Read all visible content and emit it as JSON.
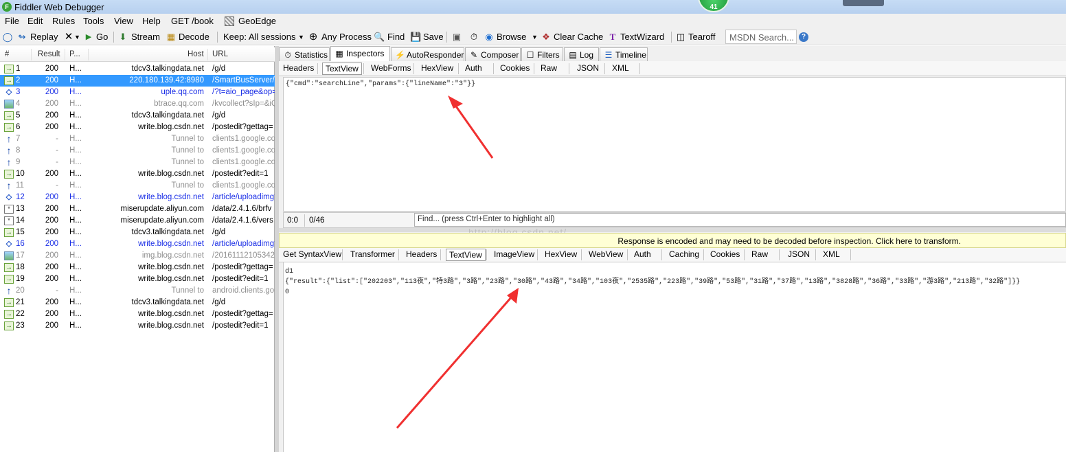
{
  "window": {
    "title": "Fiddler Web Debugger",
    "badge": "41",
    "accent_color": "#3399ff"
  },
  "menu": [
    "File",
    "Edit",
    "Rules",
    "Tools",
    "View",
    "Help",
    "GET /book",
    "GeoEdge"
  ],
  "toolbar": {
    "replay": "Replay",
    "go": "Go",
    "stream": "Stream",
    "decode": "Decode",
    "keep": "Keep: All sessions",
    "process": "Any Process",
    "find": "Find",
    "save": "Save",
    "browse": "Browse",
    "clear_cache": "Clear Cache",
    "textwizard": "TextWizard",
    "tearoff": "Tearoff",
    "msdn_placeholder": "MSDN Search..."
  },
  "sessions": {
    "columns": [
      "#",
      "Result",
      "P...",
      "Host",
      "URL"
    ],
    "rows": [
      {
        "icon": "arrow",
        "id": "1",
        "result": "200",
        "proto": "H...",
        "host": "tdcv3.talkingdata.net",
        "url": "/g/d",
        "style": "normal"
      },
      {
        "icon": "arrow",
        "id": "2",
        "result": "200",
        "proto": "H...",
        "host": "220.180.139.42:8980",
        "url": "/SmartBusServer/M",
        "style": "selected"
      },
      {
        "icon": "diamond",
        "id": "3",
        "result": "200",
        "proto": "H...",
        "host": "uple.qq.com",
        "url": "/?t=aio_page&op=",
        "style": "blue"
      },
      {
        "icon": "img",
        "id": "4",
        "result": "200",
        "proto": "H...",
        "host": "btrace.qq.com",
        "url": "/kvcollect?sIp=&iQ",
        "style": "gray"
      },
      {
        "icon": "arrow",
        "id": "5",
        "result": "200",
        "proto": "H...",
        "host": "tdcv3.talkingdata.net",
        "url": "/g/d",
        "style": "normal"
      },
      {
        "icon": "arrow",
        "id": "6",
        "result": "200",
        "proto": "H...",
        "host": "write.blog.csdn.net",
        "url": "/postedit?gettag=",
        "style": "normal"
      },
      {
        "icon": "up",
        "id": "7",
        "result": "-",
        "proto": "H...",
        "host": "Tunnel to",
        "url": "clients1.google.com",
        "style": "gray"
      },
      {
        "icon": "up",
        "id": "8",
        "result": "-",
        "proto": "H...",
        "host": "Tunnel to",
        "url": "clients1.google.com",
        "style": "gray"
      },
      {
        "icon": "up",
        "id": "9",
        "result": "-",
        "proto": "H...",
        "host": "Tunnel to",
        "url": "clients1.google.com",
        "style": "gray"
      },
      {
        "icon": "arrow",
        "id": "10",
        "result": "200",
        "proto": "H...",
        "host": "write.blog.csdn.net",
        "url": "/postedit?edit=1",
        "style": "normal"
      },
      {
        "icon": "up",
        "id": "11",
        "result": "-",
        "proto": "H...",
        "host": "Tunnel to",
        "url": "clients1.google.com",
        "style": "gray"
      },
      {
        "icon": "diamond",
        "id": "12",
        "result": "200",
        "proto": "H...",
        "host": "write.blog.csdn.net",
        "url": "/article/uploadimg?",
        "style": "blue"
      },
      {
        "icon": "js",
        "id": "13",
        "result": "200",
        "proto": "H...",
        "host": "miserupdate.aliyun.com",
        "url": "/data/2.4.1.6/brfv",
        "style": "normal"
      },
      {
        "icon": "js",
        "id": "14",
        "result": "200",
        "proto": "H...",
        "host": "miserupdate.aliyun.com",
        "url": "/data/2.4.1.6/vers",
        "style": "normal"
      },
      {
        "icon": "arrow",
        "id": "15",
        "result": "200",
        "proto": "H...",
        "host": "tdcv3.talkingdata.net",
        "url": "/g/d",
        "style": "normal"
      },
      {
        "icon": "diamond",
        "id": "16",
        "result": "200",
        "proto": "H...",
        "host": "write.blog.csdn.net",
        "url": "/article/uploadimg?",
        "style": "blue"
      },
      {
        "icon": "img",
        "id": "17",
        "result": "200",
        "proto": "H...",
        "host": "img.blog.csdn.net",
        "url": "/20161112105342",
        "style": "gray"
      },
      {
        "icon": "arrow",
        "id": "18",
        "result": "200",
        "proto": "H...",
        "host": "write.blog.csdn.net",
        "url": "/postedit?gettag=",
        "style": "normal"
      },
      {
        "icon": "arrow",
        "id": "19",
        "result": "200",
        "proto": "H...",
        "host": "write.blog.csdn.net",
        "url": "/postedit?edit=1",
        "style": "normal"
      },
      {
        "icon": "up",
        "id": "20",
        "result": "-",
        "proto": "H...",
        "host": "Tunnel to",
        "url": "android.clients.goo",
        "style": "gray"
      },
      {
        "icon": "arrow",
        "id": "21",
        "result": "200",
        "proto": "H...",
        "host": "tdcv3.talkingdata.net",
        "url": "/g/d",
        "style": "normal"
      },
      {
        "icon": "arrow",
        "id": "22",
        "result": "200",
        "proto": "H...",
        "host": "write.blog.csdn.net",
        "url": "/postedit?gettag=",
        "style": "normal"
      },
      {
        "icon": "arrow",
        "id": "23",
        "result": "200",
        "proto": "H...",
        "host": "write.blog.csdn.net",
        "url": "/postedit?edit=1",
        "style": "normal"
      }
    ]
  },
  "main_tabs": [
    "Statistics",
    "Inspectors",
    "AutoResponder",
    "Composer",
    "Filters",
    "Log",
    "Timeline"
  ],
  "request": {
    "tabs": [
      "Headers",
      "TextView",
      "WebForms",
      "HexView",
      "Auth",
      "Cookies",
      "Raw",
      "JSON",
      "XML"
    ],
    "active_tab": "TextView",
    "body": "{\"cmd\":\"searchLine\",\"params\":{\"lineName\":\"3\"}}",
    "caret": "0:0",
    "count": "0/46",
    "find_placeholder": "Find... (press Ctrl+Enter to highlight all)"
  },
  "watermark": "http://blog.csdn.net/",
  "response": {
    "warning": "Response is encoded and may need to be decoded before inspection. Click here to transform.",
    "tabs": [
      "Get SyntaxView",
      "Transformer",
      "Headers",
      "TextView",
      "ImageView",
      "HexView",
      "WebView",
      "Auth",
      "Caching",
      "Cookies",
      "Raw",
      "JSON",
      "XML"
    ],
    "active_tab": "TextView",
    "lines": [
      "d1",
      "{\"result\":{\"list\":[\"202203\",\"113夜\",\"特3路\",\"3路\",\"23路\",\"30路\",\"43路\",\"34路\",\"103夜\",\"2535路\",\"223路\",\"39路\",\"53路\",\"31路\",\"37路\",\"13路\",\"3828路\",\"36路\",\"33路\",\"游3路\",\"213路\",\"32路\"]}}",
      "0"
    ]
  }
}
